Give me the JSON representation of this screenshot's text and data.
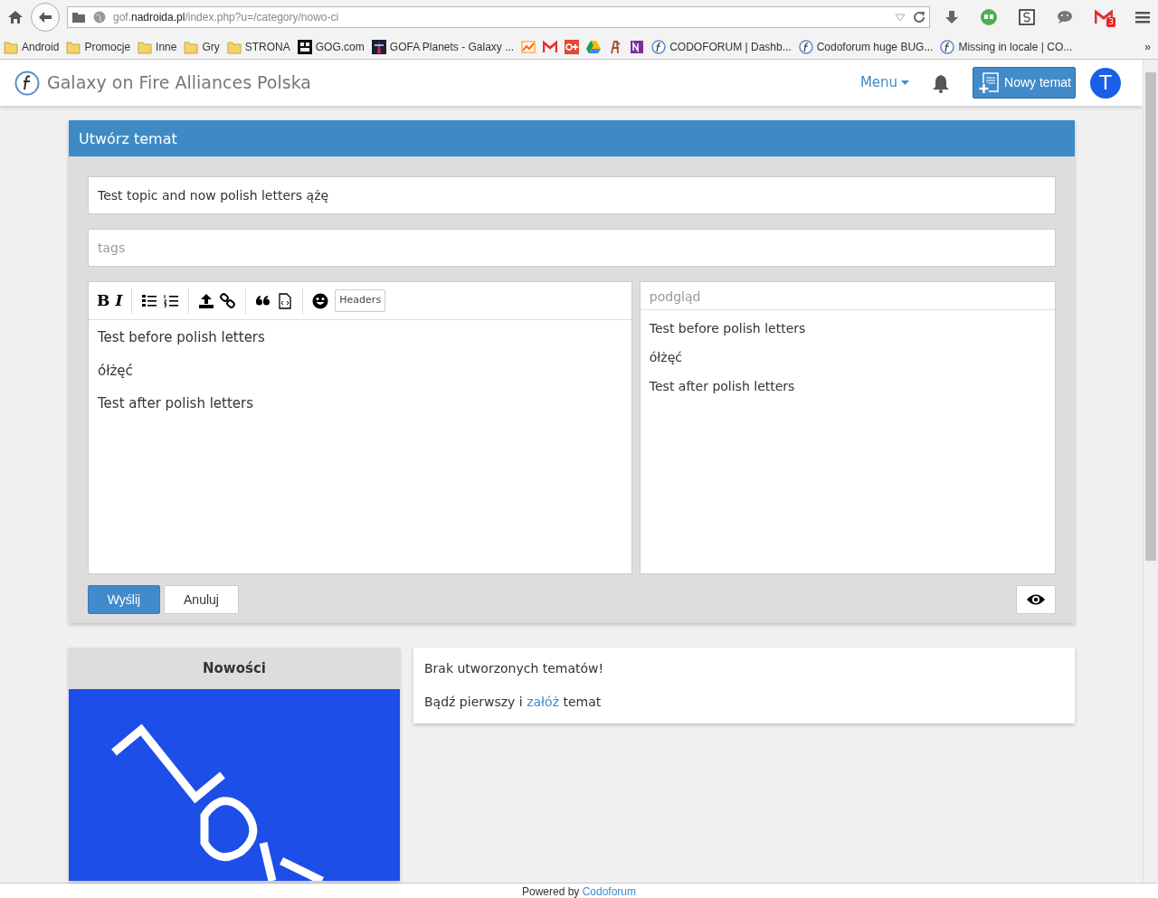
{
  "browser": {
    "url": "gof.**nadroida.pl**/index.php?u=/category/nowo-ci",
    "mail_count": "3",
    "overflow": "»",
    "bookmarks": [
      {
        "kind": "folder",
        "label": "Android"
      },
      {
        "kind": "folder",
        "label": "Promocje"
      },
      {
        "kind": "folder",
        "label": "Inne"
      },
      {
        "kind": "folder",
        "label": "Gry"
      },
      {
        "kind": "folder",
        "label": "STRONA"
      },
      {
        "kind": "gog",
        "label": "GOG.com"
      },
      {
        "kind": "game",
        "label": "GOFA Planets - Galaxy ..."
      },
      {
        "kind": "chart"
      },
      {
        "kind": "mail"
      },
      {
        "kind": "gplus"
      },
      {
        "kind": "drive"
      },
      {
        "kind": "glyph"
      },
      {
        "kind": "note"
      },
      {
        "kind": "forum",
        "label": "CODOFORUM | Dashb..."
      },
      {
        "kind": "forum",
        "label": "Codoforum huge BUG..."
      },
      {
        "kind": "forum",
        "label": "Missing in locale | CO..."
      }
    ]
  },
  "navbar": {
    "brand": "Galaxy on Fire Alliances Polska",
    "menu": "Menu",
    "new_topic": "Nowy temat",
    "avatar": "T"
  },
  "form": {
    "header": "Utwórz temat",
    "title_value": "Test topic and now polish letters ążę",
    "tags_placeholder": "tags",
    "toolbar": [
      {
        "kind": "bold",
        "label": "B"
      },
      {
        "kind": "italic",
        "label": "I"
      },
      {
        "kind": "sep"
      },
      {
        "kind": "ul"
      },
      {
        "kind": "ol"
      },
      {
        "kind": "sep"
      },
      {
        "kind": "upload"
      },
      {
        "kind": "link"
      },
      {
        "kind": "sep"
      },
      {
        "kind": "quote"
      },
      {
        "kind": "code"
      },
      {
        "kind": "sep"
      },
      {
        "kind": "smiley"
      },
      {
        "kind": "text",
        "label": "Headers"
      }
    ],
    "editor_lines": [
      "Test before polish letters",
      "ółżęć",
      "Test after polish letters"
    ],
    "preview_label": "podgląd",
    "preview_lines": [
      "Test before polish letters",
      "ółżęć",
      "Test after polish letters"
    ],
    "submit": "Wyślij",
    "cancel": "Anuluj"
  },
  "sidebar": {
    "title": "Nowości"
  },
  "notice": {
    "message": "Brak utworzonych tematów!",
    "prompt_before": "Bądź pierwszy i ",
    "prompt_link": "załóż",
    "prompt_after": " temat"
  },
  "footer": {
    "before": "Powered by ",
    "link": "Codoforum"
  }
}
